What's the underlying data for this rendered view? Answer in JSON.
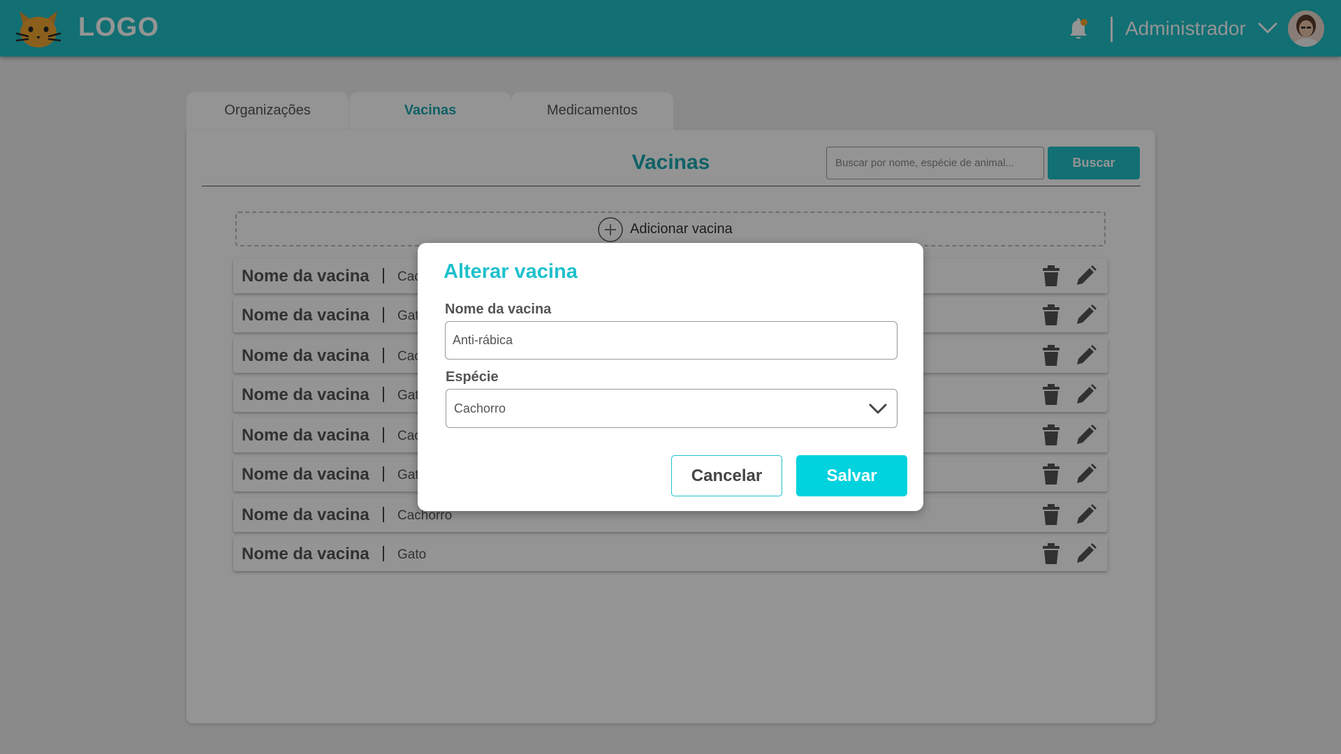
{
  "colors": {
    "header": "#1fbfc6",
    "accent": "#1ba7b0",
    "modal_accent": "#1fc0cc",
    "save_button": "#00d2de",
    "background": "#eeeeee"
  },
  "header": {
    "logo_text": "LOGO",
    "logo_icon": "cat-logo-icon",
    "notification_icon": "bell-icon",
    "user_name": "Administrador",
    "user_menu_icon": "chevron-down-icon",
    "avatar": "user-avatar"
  },
  "tabs": [
    {
      "label": "Organizações",
      "active": false
    },
    {
      "label": "Vacinas",
      "active": true
    },
    {
      "label": "Medicamentos",
      "active": false
    }
  ],
  "main": {
    "title": "Vacinas",
    "search": {
      "placeholder": "Buscar por nome, espécie de animal...",
      "value": "",
      "button_label": "Buscar"
    },
    "add_label": "Adicionar vacina",
    "add_icon": "plus-circle-icon",
    "rows": [
      {
        "name": "Nome da vacina",
        "species": "Cachorro"
      },
      {
        "name": "Nome da vacina",
        "species": "Gato"
      },
      {
        "name": "Nome da vacina",
        "species": "Cachorro"
      },
      {
        "name": "Nome da vacina",
        "species": "Gato"
      },
      {
        "name": "Nome da vacina",
        "species": "Cachorro"
      },
      {
        "name": "Nome da vacina",
        "species": "Gato"
      },
      {
        "name": "Nome da vacina",
        "species": "Cachorro"
      },
      {
        "name": "Nome da vacina",
        "species": "Gato"
      }
    ],
    "row_icons": {
      "delete": "trash-icon",
      "edit": "pencil-icon"
    }
  },
  "modal": {
    "title": "Alterar vacina",
    "name_label": "Nome da vacina",
    "name_value": "Anti-rábica",
    "species_label": "Espécie",
    "species_value": "Cachorro",
    "cancel_label": "Cancelar",
    "save_label": "Salvar"
  }
}
